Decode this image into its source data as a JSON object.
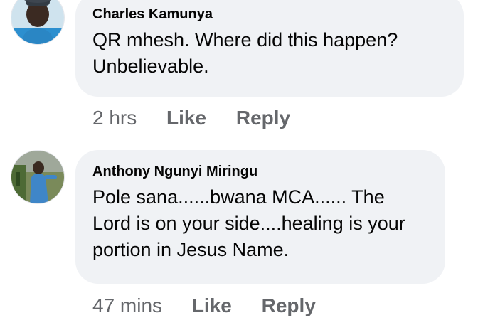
{
  "comments": [
    {
      "author": "Charles Kamunya",
      "text": "QR mhesh. Where did this happen? Unbelievable.",
      "time": "2 hrs",
      "like_label": "Like",
      "reply_label": "Reply"
    },
    {
      "author": "Anthony Ngunyi Miringu",
      "text": "Pole sana......bwana MCA...... The Lord is on your side....healing is your portion in Jesus Name.",
      "time": "47 mins",
      "like_label": "Like",
      "reply_label": "Reply"
    }
  ],
  "colors": {
    "bubble_bg": "#f0f2f5",
    "meta_text": "#65676b",
    "body_text": "#050505"
  }
}
